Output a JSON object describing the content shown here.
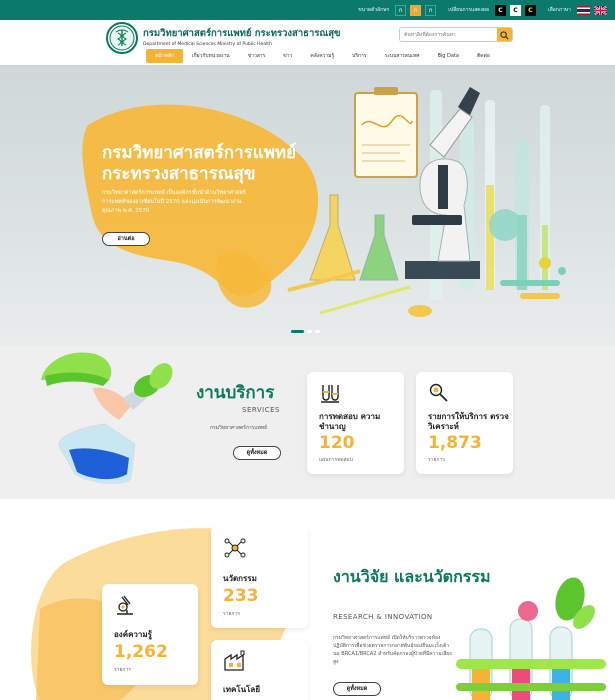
{
  "topbar": {
    "font_size_label": "ขนาดตัวอักษร",
    "font_sizes": [
      "ก",
      "ก",
      "ก"
    ],
    "contrast_label": "เปลี่ยนการแสดงผล",
    "contrast_options": [
      "C",
      "C",
      "C"
    ],
    "language_label": "เลือกภาษา",
    "languages": [
      "thai-flag",
      "uk-flag"
    ]
  },
  "header": {
    "title_th": "กรมวิทยาศาสตร์การแพทย์ กระทรวงสาธารณสุข",
    "title_en": "Department of Medical Sciences Ministry of Public Health",
    "search_placeholder": "ค้นหาสิ่งที่ต้องการค้นหา",
    "nav": [
      "หน้าหลัก",
      "เกี่ยวกับหน่วยงาน",
      "ข่าวสาร",
      "ข่าว",
      "คลังความรู้",
      "บริการ",
      "ระบบสารสนเทศ",
      "Big Data",
      "ติดต่อ"
    ]
  },
  "hero": {
    "title": "กรมวิทยาศาสตร์การแพทย์ กระทรวงสาธารณสุข",
    "description": "กรมวิทยาศาสตร์การแพทย์ เป็นองค์กรชั้นนำด้านวิทยาศาสตร์การแพทย์ของอาเซียนในปี 2570 และมุ่งเน้นการพัฒนางานคุณภาพ พ.ศ. 2570",
    "button": "อ่านต่อ",
    "slides": 3,
    "active_slide": 1
  },
  "services": {
    "title": "งานบริการ",
    "subtitle": "SERVICES",
    "description": "กรมวิทยาศาสตร์การแพทย์",
    "button": "ดูทั้งหมด",
    "cards": [
      {
        "icon": "test-tubes-icon",
        "title": "การทดสอบ ความชำนาญ",
        "value": "120",
        "unit": "แผนการทดสอบ"
      },
      {
        "icon": "microscope-magnifier-icon",
        "title": "รายการให้บริการ ตรวจวิเคราะห์",
        "value": "1,873",
        "unit": "รายการ"
      }
    ]
  },
  "research": {
    "title": "งานวิจัย และนวัตกรรม",
    "subtitle": "RESEARCH & INNOVATION",
    "description": "กรมวิทยาศาสตร์การแพทย์ เปิดให้บริการตรวจห้องปฏิบัติการเพื่อช่วยตรวจการกลายพันธุ์ของยีนมะเร็งเต้านม BRCA1/BRCA2 สำหรับคัดกรองผู้ป่วยที่มีความเสี่ยงสูง",
    "button": "ดูทั้งหมด",
    "cards": [
      {
        "icon": "molecule-network-icon",
        "title": "นวัตกรรม",
        "value": "233",
        "unit": "รายการ"
      },
      {
        "icon": "microscope-icon",
        "title": "องค์ความรู้",
        "value": "1,262",
        "unit": "รายการ"
      },
      {
        "icon": "factory-icon",
        "title": "เทคโนโลยี",
        "value": "",
        "unit": ""
      }
    ]
  },
  "colors": {
    "primary": "#0b7a6c",
    "accent": "#f5b335",
    "heading": "#0a7a5c"
  }
}
